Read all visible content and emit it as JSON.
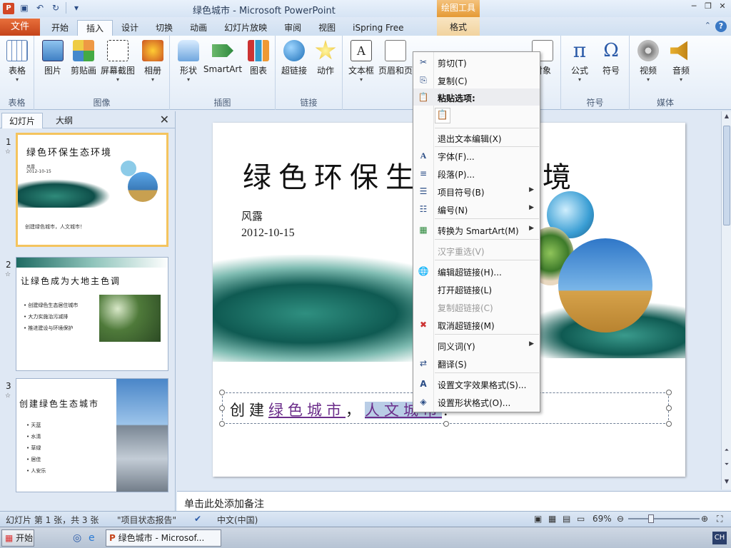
{
  "window": {
    "title": "绿色城市 - Microsoft PowerPoint",
    "drawing_tools": "绘图工具",
    "app_icon": "P"
  },
  "tabs": {
    "file": "文件",
    "items": [
      "开始",
      "插入",
      "设计",
      "切换",
      "动画",
      "幻灯片放映",
      "审阅",
      "视图",
      "iSpring Free"
    ],
    "format": "格式"
  },
  "ribbon": {
    "groups": [
      {
        "label": "表格",
        "buttons": [
          "表格"
        ]
      },
      {
        "label": "图像",
        "buttons": [
          "图片",
          "剪贴画",
          "屏幕截图",
          "相册"
        ]
      },
      {
        "label": "插图",
        "buttons": [
          "形状",
          "SmartArt",
          "图表"
        ]
      },
      {
        "label": "链接",
        "buttons": [
          "超链接",
          "动作"
        ]
      },
      {
        "label": "",
        "buttons": [
          "文本框",
          "页眉和页",
          "",
          "",
          "对象"
        ]
      },
      {
        "label": "符号",
        "buttons": [
          "公式",
          "符号"
        ]
      },
      {
        "label": "媒体",
        "buttons": [
          "视频",
          "音频"
        ]
      }
    ]
  },
  "panel": {
    "tabs": [
      "幻灯片",
      "大纲"
    ],
    "slides": [
      {
        "num": "1",
        "title": "绿色环保生态环境",
        "author": "风露",
        "date": "2012-10-15",
        "footer": "创建绿色城市，人文城市！"
      },
      {
        "num": "2",
        "title": "让绿色成为大地主色调",
        "bullets": [
          "创建绿色生态居住城市",
          "大力实施治污减排",
          "推进建设与环境保护"
        ]
      },
      {
        "num": "3",
        "title": "创建绿色生态城市",
        "bullets": [
          "天蓝",
          "水清",
          "草绿",
          "居佳",
          "人安乐"
        ]
      }
    ]
  },
  "slide": {
    "title": "绿色环保生",
    "title_end": "境",
    "author": "风露",
    "date": "2012-10-15",
    "textbox": {
      "pre": "创建",
      "link1": "绿色城市",
      "comma": "，",
      "link2": "人文城市",
      "end": "！"
    }
  },
  "notes": {
    "placeholder": "单击此处添加备注"
  },
  "status": {
    "slide_info": "幻灯片 第 1 张，共 3 张",
    "theme": "\"项目状态报告\"",
    "lang": "中文(中国)",
    "zoom": "69%",
    "zoom_level": 0.69
  },
  "taskbar": {
    "start": "开始",
    "task": "绿色城市 - Microsof...",
    "ime": "CH"
  },
  "context_menu": {
    "cut": "剪切(T)",
    "copy": "复制(C)",
    "paste_options": "粘贴选项:",
    "exit_edit": "退出文本编辑(X)",
    "font": "字体(F)...",
    "paragraph": "段落(P)...",
    "bullets": "项目符号(B)",
    "numbering": "编号(N)",
    "smartart": "转换为 SmartArt(M)",
    "reconvert": "汉字重选(V)",
    "edit_link": "编辑超链接(H)...",
    "open_link": "打开超链接(L)",
    "copy_link": "复制超链接(C)",
    "remove_link": "取消超链接(M)",
    "synonyms": "同义词(Y)",
    "translate": "翻译(S)",
    "text_effects": "设置文字效果格式(S)...",
    "shape_format": "设置形状格式(O)..."
  },
  "colors": {
    "file_tab": "#c5441a",
    "accent": "#3a78c4",
    "link": "#6b2d8a",
    "selection": "#f4c45e"
  }
}
